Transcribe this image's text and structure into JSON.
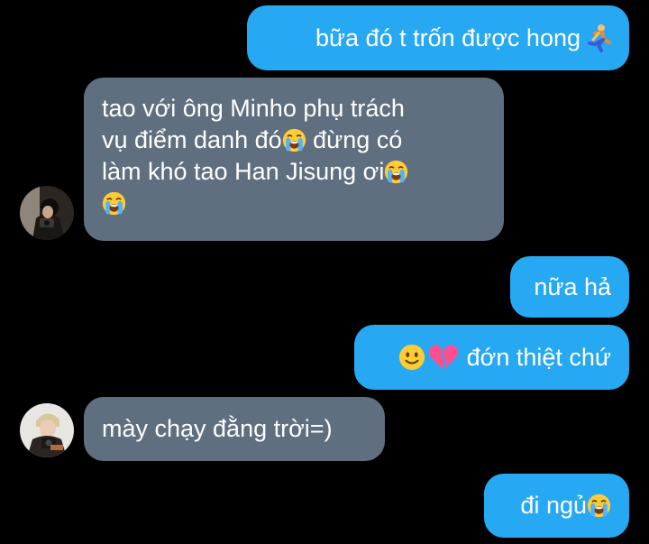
{
  "colors": {
    "background": "#000000",
    "sent_bubble": "#27a8f2",
    "received_bubble": "#5f6f7f",
    "text": "#ffffff"
  },
  "messages": [
    {
      "direction": "sent",
      "text": "bữa đó t trốn được hong",
      "emoji": "running-person-icon"
    },
    {
      "direction": "received",
      "lines": [
        "tao với ông Minho phụ trách",
        "vụ điểm danh đó",
        "đừng có",
        "làm khó tao Han Jisung ơi"
      ],
      "emoji": "loudly-crying-face-icon"
    },
    {
      "direction": "sent",
      "text": "nữa hả"
    },
    {
      "direction": "sent",
      "text": "đớn thiệt chứ",
      "emojis": [
        "slightly-smiling-face-icon",
        "broken-heart-icon"
      ]
    },
    {
      "direction": "received",
      "text": "mày chạy đằng trời=)"
    },
    {
      "direction": "sent",
      "text": "đi ngủ",
      "emoji": "loudly-crying-face-icon"
    }
  ]
}
